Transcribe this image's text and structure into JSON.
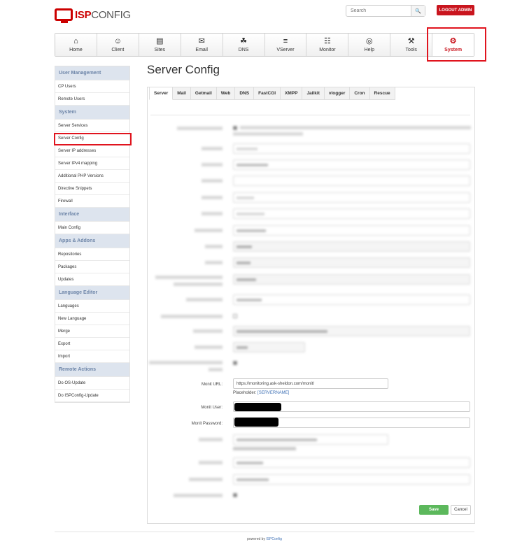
{
  "header": {
    "logo_bold": "ISP",
    "logo_thin": "CONFIG",
    "search_placeholder": "Search",
    "logout_label": "LOGOUT ADMIN"
  },
  "nav": {
    "items": [
      {
        "label": "Home",
        "icon": "home-icon"
      },
      {
        "label": "Client",
        "icon": "users-icon"
      },
      {
        "label": "Sites",
        "icon": "sites-icon"
      },
      {
        "label": "Email",
        "icon": "envelope-icon"
      },
      {
        "label": "DNS",
        "icon": "sitemap-icon"
      },
      {
        "label": "VServer",
        "icon": "server-icon"
      },
      {
        "label": "Monitor",
        "icon": "traffic-light-icon"
      },
      {
        "label": "Help",
        "icon": "lifebuoy-icon"
      },
      {
        "label": "Tools",
        "icon": "tools-icon"
      },
      {
        "label": "System",
        "icon": "gear-icon"
      }
    ],
    "active": "System"
  },
  "sidebar": {
    "sections": [
      {
        "title": "User Management",
        "items": [
          "CP Users",
          "Remote Users"
        ]
      },
      {
        "title": "System",
        "items": [
          "Server Services",
          "Server Config",
          "Server IP addresses",
          "Server IPv4 mapping",
          "Additional PHP Versions",
          "Directive Snippets",
          "Firewall"
        ]
      },
      {
        "title": "Interface",
        "items": [
          "Main Config"
        ]
      },
      {
        "title": "Apps & Addons",
        "items": [
          "Repositories",
          "Packages",
          "Updates"
        ]
      },
      {
        "title": "Language Editor",
        "items": [
          "Languages",
          "New Language",
          "Merge",
          "Export",
          "Import"
        ]
      },
      {
        "title": "Remote Actions",
        "items": [
          "Do OS-Update",
          "Do ISPConfig-Update"
        ]
      }
    ]
  },
  "page": {
    "title": "Server Config",
    "tabs": [
      "Server",
      "Mail",
      "Getmail",
      "Web",
      "DNS",
      "FastCGI",
      "XMPP",
      "Jailkit",
      "vlogger",
      "Cron",
      "Rescue"
    ]
  },
  "form": {
    "monit_url_label": "Monit URL:",
    "monit_url_value": "https://monitoring.ask-sheldon.com/monit/",
    "monit_placeholder_prefix": "Placeholder:",
    "monit_placeholder_token": "[SERVERNAME]",
    "monit_user_label": "Monit User:",
    "monit_password_label": "Monit Password:",
    "save_label": "Save",
    "cancel_label": "Cancel"
  },
  "footer": {
    "prefix": "powered by",
    "link": "ISPConfig"
  },
  "colors": {
    "accent_red": "#c9151e",
    "sidebar_head_bg": "#dde4ee",
    "sidebar_head_text": "#6d85a8",
    "save_green": "#5cb85c",
    "link_blue": "#3f71b5"
  }
}
